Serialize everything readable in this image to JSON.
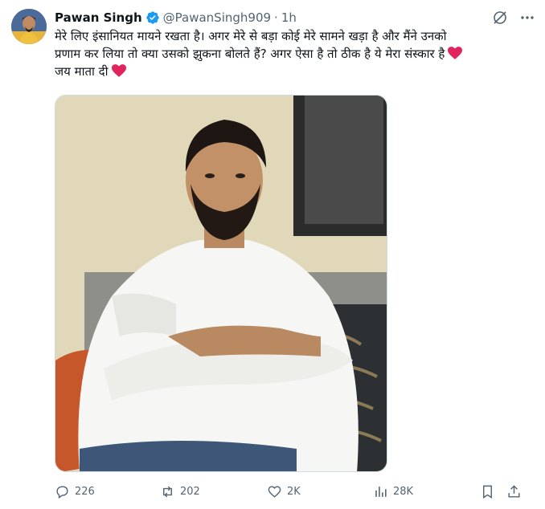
{
  "tweet": {
    "author_name": "Pawan Singh",
    "handle": "@PawanSingh909",
    "separator": "·",
    "time": "1h",
    "lines": [
      "मेरे लिए इंसानियत मायने रखता है। अगर मेरे से बड़ा कोई मेरे सामने खड़ा है और मैंने उनको",
      "प्रणाम कर लिया तो क्या उसको झुकना बोलते हैं? अगर ऐसा है तो ठीक है ये मेरा संस्कार है",
      "जय माता दी"
    ],
    "heart_icon": "red-heart-icon",
    "verified_color": "#1d9bf0",
    "heart_color": "#e0245e"
  },
  "header_icons": [
    "grok-icon",
    "more-icon"
  ],
  "actions": {
    "replies": "226",
    "reposts": "202",
    "likes": "2K",
    "views": "28K"
  },
  "colors": {
    "text": "#0f1419",
    "secondary": "#536471",
    "border": "#cfd9de"
  }
}
